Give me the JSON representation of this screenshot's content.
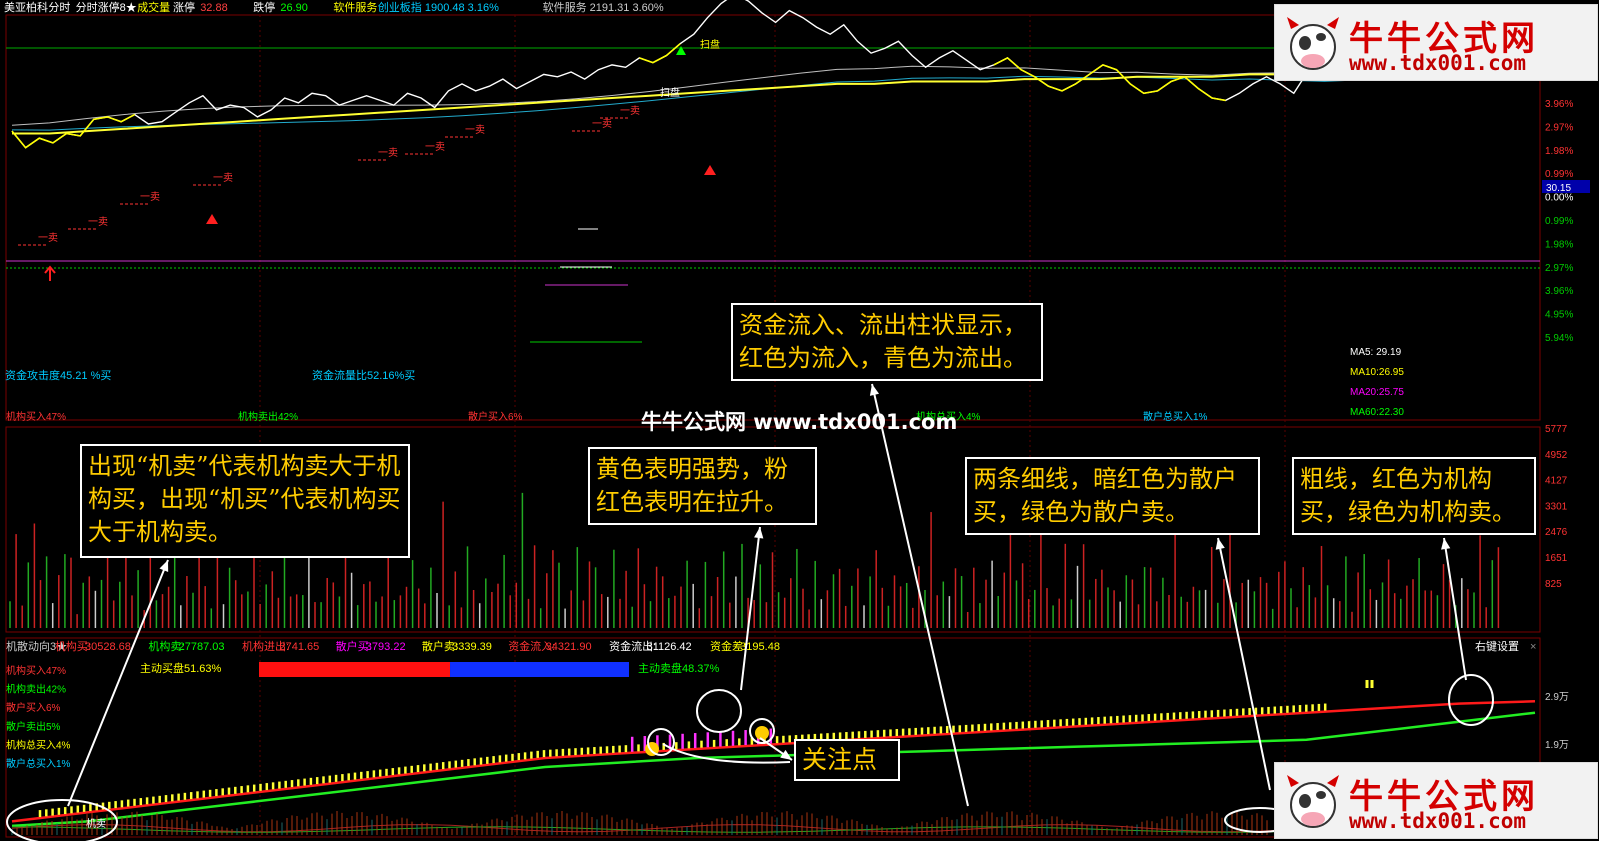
{
  "header": {
    "items": [
      {
        "t": "美亚柏科",
        "c": "#ffffff"
      },
      {
        "t": "分时",
        "c": "#ffffff"
      },
      {
        "t": "分时涨停8★",
        "c": "#ffffff"
      },
      {
        "t": "成交量",
        "c": "#ffff00"
      },
      {
        "t": "涨停",
        "c": "#ffffff"
      },
      {
        "t": "32.88",
        "c": "#ff4040"
      },
      {
        "t": "跌停",
        "c": "#ffffff"
      },
      {
        "t": "26.90",
        "c": "#00ff00"
      },
      {
        "t": "软件服务",
        "c": "#ffff00"
      },
      {
        "t": "创业板指 1900.48 3.16%",
        "c": "#00ccff"
      },
      {
        "t": "软件服务 2191.31 3.60%",
        "c": "#cccccc"
      }
    ]
  },
  "price_axis": {
    "labels": [
      "3.96%",
      "2.97%",
      "1.98%",
      "0.99%",
      "0.00%",
      "0.99%",
      "1.98%",
      "2.97%",
      "3.96%",
      "4.95%",
      "5.94%"
    ],
    "current": "30.15"
  },
  "ma_legend": [
    {
      "t": "MA5: 29.19",
      "c": "#ffffff"
    },
    {
      "t": "MA10:26.95",
      "c": "#ffff00"
    },
    {
      "t": "MA20:25.75",
      "c": "#ff00ff"
    },
    {
      "t": "MA60:22.30",
      "c": "#00ff00"
    }
  ],
  "price_texts": {
    "attack": "资金攻击度45.21 %买",
    "flow_ratio": "资金流量比52.16%买"
  },
  "volume_header": [
    {
      "t": "机构买入47%",
      "c": "#ff3333"
    },
    {
      "t": "机构卖出42%",
      "c": "#00ff00"
    },
    {
      "t": "散户买入6%",
      "c": "#ff3333"
    },
    {
      "t": "机构总买入4%",
      "c": "#00ff00"
    },
    {
      "t": "散户总买入1%",
      "c": "#00ccff"
    }
  ],
  "volume_axis": [
    "5777",
    "4952",
    "4127",
    "3301",
    "2476",
    "1651",
    "825"
  ],
  "indicator_header": [
    {
      "t": "机散动向3★",
      "c": "#cccccc"
    },
    {
      "t": "机构买:",
      "c": "#ff3333"
    },
    {
      "t": "30528.68",
      "c": "#ff3333"
    },
    {
      "t": "机构卖:",
      "c": "#00ff00"
    },
    {
      "t": "27787.03",
      "c": "#00ff00"
    },
    {
      "t": "机构进出:",
      "c": "#ff3333"
    },
    {
      "t": "2741.65",
      "c": "#ff3333"
    },
    {
      "t": "散户买:",
      "c": "#ff00ff"
    },
    {
      "t": "3793.22",
      "c": "#ff00ff"
    },
    {
      "t": "散户卖:",
      "c": "#ffff00"
    },
    {
      "t": "3339.39",
      "c": "#ffff00"
    },
    {
      "t": "资金流入:",
      "c": "#ff3333"
    },
    {
      "t": "34321.90",
      "c": "#ff3333"
    },
    {
      "t": "资金流出:",
      "c": "#ffffff"
    },
    {
      "t": "31126.42",
      "c": "#ffffff"
    },
    {
      "t": "资金差:",
      "c": "#ffff00"
    },
    {
      "t": "3195.48",
      "c": "#ffff00"
    }
  ],
  "right_settings": "右键设置",
  "close_glyph": "×",
  "indicator_left": [
    {
      "t": "机构买入47%",
      "c": "#ff3333"
    },
    {
      "t": "机构卖出42%",
      "c": "#00ff00"
    },
    {
      "t": "散户买入6%",
      "c": "#ff3333"
    },
    {
      "t": "散户卖出5%",
      "c": "#00ff00"
    },
    {
      "t": "机构总买入4%",
      "c": "#ffff00"
    },
    {
      "t": "散户总买入1%",
      "c": "#00ccff"
    }
  ],
  "buy_ratio": {
    "left": "主动买盘51.63%",
    "right": "主动卖盘48.37%",
    "buy": 51.63
  },
  "indicator_axis": [
    "2.9万",
    "1.9万"
  ],
  "annotations": {
    "a1": "资金流入、流出柱状显示，红色为流入，青色为流出。",
    "a2": "出现“机卖”代表机构卖大于机构买，出现“机买”代表机构买大于机构卖。",
    "a3": "黄色表明强势，粉红色表明在拉升。",
    "a4": "两条细线，暗红色为散户买，绿色为散户卖。",
    "a5": "粗线，红色为机构买，绿色为机构卖。",
    "a6": "关注点"
  },
  "watermark": "牛牛公式网 www.tdx001.com",
  "logo": {
    "title": "牛牛公式网",
    "url": "www.tdx001.com"
  },
  "markers": {
    "sell": "一卖",
    "buy": "一买",
    "sweep": "扫盘",
    "jimai": "机卖"
  },
  "chart_data": [
    {
      "type": "line",
      "name": "intraday price",
      "y_unit": "%",
      "ylim": [
        -5.94,
        3.96
      ],
      "y": [
        -0.2,
        -0.9,
        -0.5,
        -0.7,
        -0.3,
        -0.4,
        0.3,
        0.4,
        0.2,
        0.5,
        0.1,
        0.2,
        0.6,
        1.0,
        1.3,
        0.7,
        0.9,
        0.8,
        0.4,
        0.7,
        1.2,
        1.0,
        1.4,
        1.3,
        0.9,
        1.1,
        1.3,
        1.1,
        0.9,
        1.4,
        1.2,
        0.8,
        1.5,
        1.8,
        1.5,
        1.7,
        2.0,
        1.6,
        1.9,
        2.2,
        2.1,
        2.3,
        2.0,
        2.4,
        2.6,
        2.5,
        2.9,
        2.7,
        3.0,
        3.5,
        3.9,
        4.6,
        5.2,
        5.6,
        5.3,
        4.8,
        4.4,
        4.9,
        4.6,
        4.2,
        3.9,
        4.3,
        3.6,
        3.1,
        3.3,
        3.6,
        3.0,
        2.5,
        2.9,
        3.2,
        2.8,
        2.4,
        2.6,
        2.9,
        2.4,
        2.1,
        1.7,
        1.5,
        1.8,
        2.2,
        2.6,
        2.4,
        1.8,
        1.4,
        1.5,
        1.9,
        2.1,
        1.6,
        1.2,
        1.1,
        1.4,
        1.8,
        2.1,
        1.8,
        1.4,
        2.3,
        2.9,
        3.4,
        2.8,
        2.3,
        2.6,
        3.2,
        3.8,
        3.6,
        3.1,
        2.6,
        3.0,
        3.4,
        3.3,
        3.1,
        2.9
      ]
    },
    {
      "type": "line",
      "name": "average price",
      "y_unit": "%",
      "y": [
        -0.3,
        -0.3,
        -0.2,
        -0.1,
        0.0,
        0.1,
        0.2,
        0.3,
        0.4,
        0.5,
        0.6,
        0.7,
        0.8,
        0.9,
        1.0,
        1.1,
        1.2,
        1.3,
        1.4,
        1.5,
        1.6,
        1.7,
        1.8,
        1.8,
        1.9,
        1.9,
        1.9,
        2.0,
        2.0,
        2.0,
        2.1,
        2.1,
        2.1,
        2.2,
        2.2,
        2.2,
        2.3,
        2.3,
        2.4,
        2.5,
        2.6
      ]
    },
    {
      "type": "bar",
      "name": "volume",
      "ylim": [
        0,
        5777
      ],
      "values": [
        1300,
        2500,
        900,
        1800,
        3600,
        1400,
        2200,
        800,
        1500,
        2700,
        1900,
        600,
        1200,
        2300,
        1000,
        1800,
        2600,
        900,
        1400,
        2100,
        1100,
        1600,
        700,
        2400,
        1300,
        900,
        1700,
        2000,
        800,
        1500,
        1100,
        2800,
        1200,
        700,
        1900,
        1000,
        1600,
        2200,
        900,
        1400,
        3500,
        800,
        1300,
        1700,
        1000,
        2100,
        1200,
        900,
        1500,
        2600,
        1100,
        700,
        1800,
        1300,
        1000,
        2300,
        1600,
        800,
        1200,
        1900,
        700,
        1500,
        2700,
        1100,
        900,
        1400,
        2000,
        1200,
        800,
        1700,
        1300,
        3400,
        1000,
        1500,
        900,
        2200,
        1400,
        700,
        1600,
        1100
      ]
    },
    {
      "type": "line",
      "name": "机构买",
      "y": [
        0.3,
        0.5,
        0.7,
        0.9,
        1.1,
        1.3,
        1.5,
        1.7,
        1.8,
        1.9,
        2.0,
        2.1,
        2.2,
        2.3,
        2.4,
        2.5,
        2.6,
        2.7,
        2.8,
        2.9,
        2.95
      ]
    },
    {
      "type": "line",
      "name": "机构卖",
      "y": [
        0.2,
        0.3,
        0.5,
        0.7,
        0.9,
        1.1,
        1.3,
        1.5,
        1.6,
        1.7,
        1.75,
        1.8,
        1.85,
        1.9,
        1.95,
        2.0,
        2.05,
        2.1,
        2.3,
        2.5,
        2.7
      ]
    }
  ]
}
